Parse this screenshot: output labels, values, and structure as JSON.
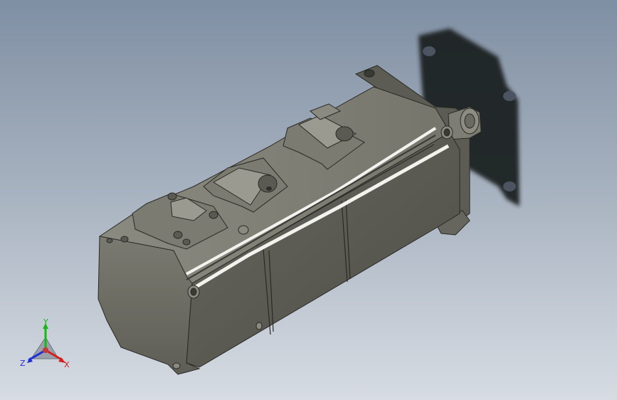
{
  "viewport": {
    "background_top": "#7f8fa3",
    "background_bottom": "#d7dce3"
  },
  "model": {
    "body_color": "#6f6f66",
    "body_dark": "#55554d",
    "highlight": "#f2f2ee",
    "shadow_color": "#1e2024"
  },
  "triad": {
    "labels": {
      "y": "Y",
      "z": "Z",
      "x": "X"
    },
    "colors": {
      "y": "#1bb51b",
      "z": "#1f2fd6",
      "x": "#d61f1f"
    }
  }
}
